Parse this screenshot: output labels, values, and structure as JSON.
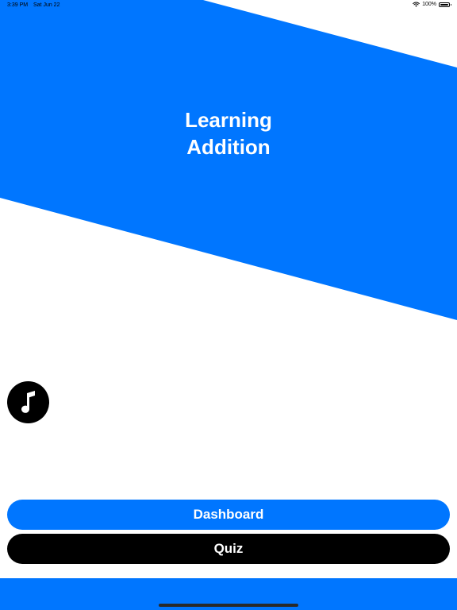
{
  "status_bar": {
    "time": "3:39 PM",
    "date": "Sat Jun 22",
    "battery": "100%",
    "icons": [
      "wifi-icon",
      "battery-icon"
    ]
  },
  "header": {
    "title_line1": "Learning",
    "title_line2": "Addition"
  },
  "music_button": {
    "icon": "music-note-icon"
  },
  "buttons": {
    "dashboard_label": "Dashboard",
    "quiz_label": "Quiz"
  },
  "colors": {
    "accent": "#0076FF",
    "background": "#FFFFFF",
    "dark": "#000000"
  }
}
